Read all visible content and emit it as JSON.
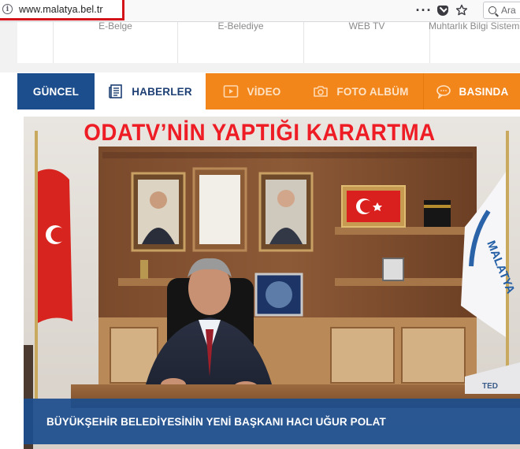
{
  "browser": {
    "url": "www.malatya.bel.tr",
    "search_placeholder": "Ara"
  },
  "top_nav": {
    "items": [
      "E-Belge",
      "E-Belediye",
      "WEB TV",
      "Muhtarlık Bilgi Sistemi"
    ]
  },
  "tabs": [
    {
      "label": "GÜNCEL",
      "icon": "none"
    },
    {
      "label": "HABERLER",
      "icon": "newspaper-icon"
    },
    {
      "label": "VİDEO",
      "icon": "video-play-icon"
    },
    {
      "label": "FOTO ALBÜM",
      "icon": "camera-icon"
    },
    {
      "label": "BASINDA",
      "icon": "speech-bubble-icon"
    }
  ],
  "overlay_title": "ODATV’NİN YAPTIĞI KARARTMA",
  "slide": {
    "caption": "BÜYÜKŞEHİR BELEDİYESİNİN YENİ BAŞKANI HACI UĞUR POLAT",
    "flag_text": "MALATYA BÜYÜKŞEHİR BELEDİYESİ",
    "desk_sign_text": "TED"
  },
  "colors": {
    "accent_blue": "#1c4e8d",
    "tab_orange": "#f2861a",
    "highlight_red": "#ee1c24"
  }
}
